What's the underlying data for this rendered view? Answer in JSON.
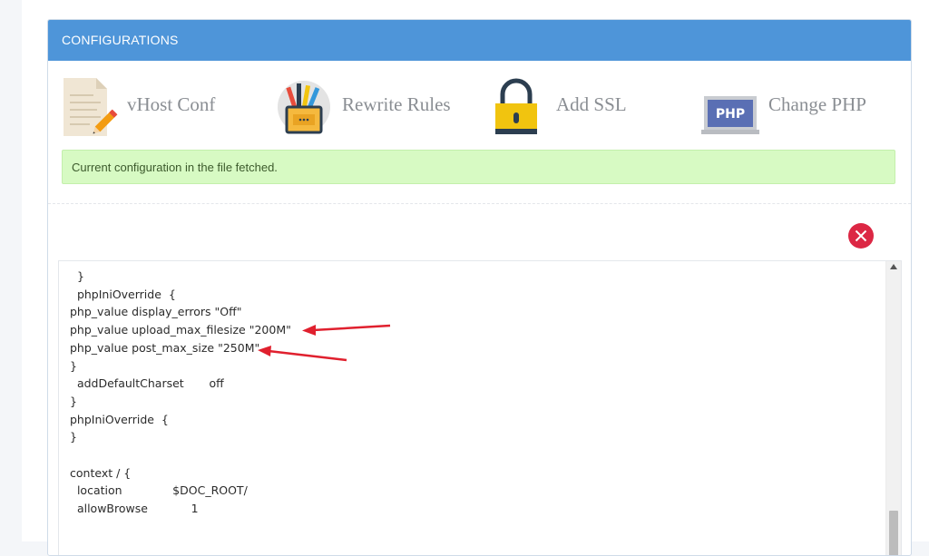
{
  "panel": {
    "title": "CONFIGURATIONS"
  },
  "actions": [
    {
      "label": "vHost Conf",
      "icon": "document-pencil-icon"
    },
    {
      "label": "Rewrite Rules",
      "icon": "pencil-cup-icon"
    },
    {
      "label": "Add SSL",
      "icon": "padlock-icon"
    },
    {
      "label": "Change PHP",
      "icon": "php-laptop-icon",
      "badge": "PHP"
    }
  ],
  "alert": {
    "message": "Current configuration in the file fetched."
  },
  "editor": {
    "content": "  }\n  phpIniOverride  {\nphp_value display_errors \"Off\"\nphp_value upload_max_filesize \"200M\"\nphp_value post_max_size \"250M\"\n}\n  addDefaultCharset       off\n}\nphpIniOverride  {\n}\n\ncontext / {\n  location              $DOC_ROOT/\n  allowBrowse            1"
  },
  "colors": {
    "header": "#4e95d9",
    "alert_bg": "#d7fac3",
    "close_button": "#dc2744",
    "annotation_arrow": "#e0202e"
  }
}
